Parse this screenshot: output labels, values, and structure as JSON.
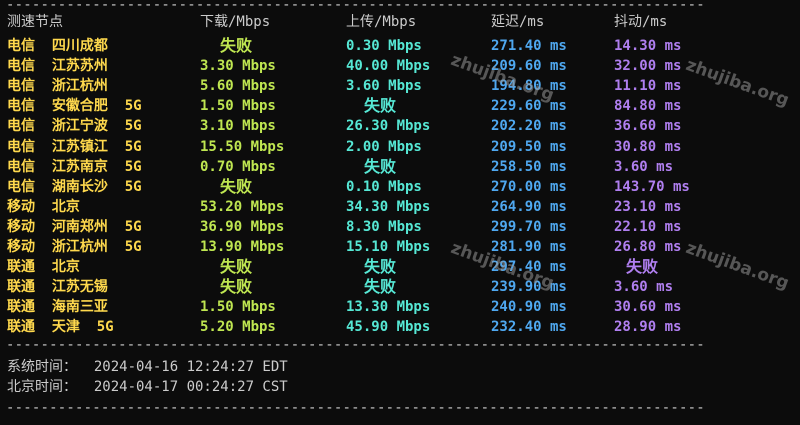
{
  "separator": "--------------------------------------------------------------------------------------------------",
  "headers": {
    "node": "测速节点",
    "download": "下载/Mbps",
    "upload": "上传/Mbps",
    "latency": "延迟/ms",
    "jitter": "抖动/ms"
  },
  "rows": [
    {
      "node": "电信  四川成都",
      "download": "失败",
      "upload": "0.30 Mbps",
      "latency": "271.40 ms",
      "jitter": "14.30 ms"
    },
    {
      "node": "电信  江苏苏州",
      "download": "3.30 Mbps",
      "upload": "40.00 Mbps",
      "latency": "209.60 ms",
      "jitter": "32.00 ms"
    },
    {
      "node": "电信  浙江杭州",
      "download": "5.60 Mbps",
      "upload": "3.60 Mbps",
      "latency": "194.80 ms",
      "jitter": "11.10 ms"
    },
    {
      "node": "电信  安徽合肥  5G",
      "download": "1.50 Mbps",
      "upload": "失败",
      "latency": "229.60 ms",
      "jitter": "84.80 ms"
    },
    {
      "node": "电信  浙江宁波  5G",
      "download": "3.10 Mbps",
      "upload": "26.30 Mbps",
      "latency": "202.20 ms",
      "jitter": "36.60 ms"
    },
    {
      "node": "电信  江苏镇江  5G",
      "download": "15.50 Mbps",
      "upload": "2.00 Mbps",
      "latency": "209.50 ms",
      "jitter": "30.80 ms"
    },
    {
      "node": "电信  江苏南京  5G",
      "download": "0.70 Mbps",
      "upload": "失败",
      "latency": "258.50 ms",
      "jitter": "3.60 ms"
    },
    {
      "node": "电信  湖南长沙  5G",
      "download": "失败",
      "upload": "0.10 Mbps",
      "latency": "270.00 ms",
      "jitter": "143.70 ms"
    },
    {
      "node": "移动  北京",
      "download": "53.20 Mbps",
      "upload": "34.30 Mbps",
      "latency": "264.90 ms",
      "jitter": "23.10 ms"
    },
    {
      "node": "移动  河南郑州  5G",
      "download": "36.90 Mbps",
      "upload": "8.30 Mbps",
      "latency": "299.70 ms",
      "jitter": "22.10 ms"
    },
    {
      "node": "移动  浙江杭州  5G",
      "download": "13.90 Mbps",
      "upload": "15.10 Mbps",
      "latency": "281.90 ms",
      "jitter": "26.80 ms"
    },
    {
      "node": "联通  北京",
      "download": "失败",
      "upload": "失败",
      "latency": "297.40 ms",
      "jitter": "失败"
    },
    {
      "node": "联通  江苏无锡",
      "download": "失败",
      "upload": "失败",
      "latency": "239.90 ms",
      "jitter": "3.60 ms"
    },
    {
      "node": "联通  海南三亚",
      "download": "1.50 Mbps",
      "upload": "13.30 Mbps",
      "latency": "240.90 ms",
      "jitter": "30.60 ms"
    },
    {
      "node": "联通  天津  5G",
      "download": "5.20 Mbps",
      "upload": "45.90 Mbps",
      "latency": "232.40 ms",
      "jitter": "28.90 ms"
    }
  ],
  "footer": {
    "system_time": "系统时间：  2024-04-16 12:24:27 EDT",
    "beijing_time": "北京时间：  2024-04-17 00:24:27 CST"
  },
  "watermark": "zhujiba.org",
  "fail_text": "失败"
}
